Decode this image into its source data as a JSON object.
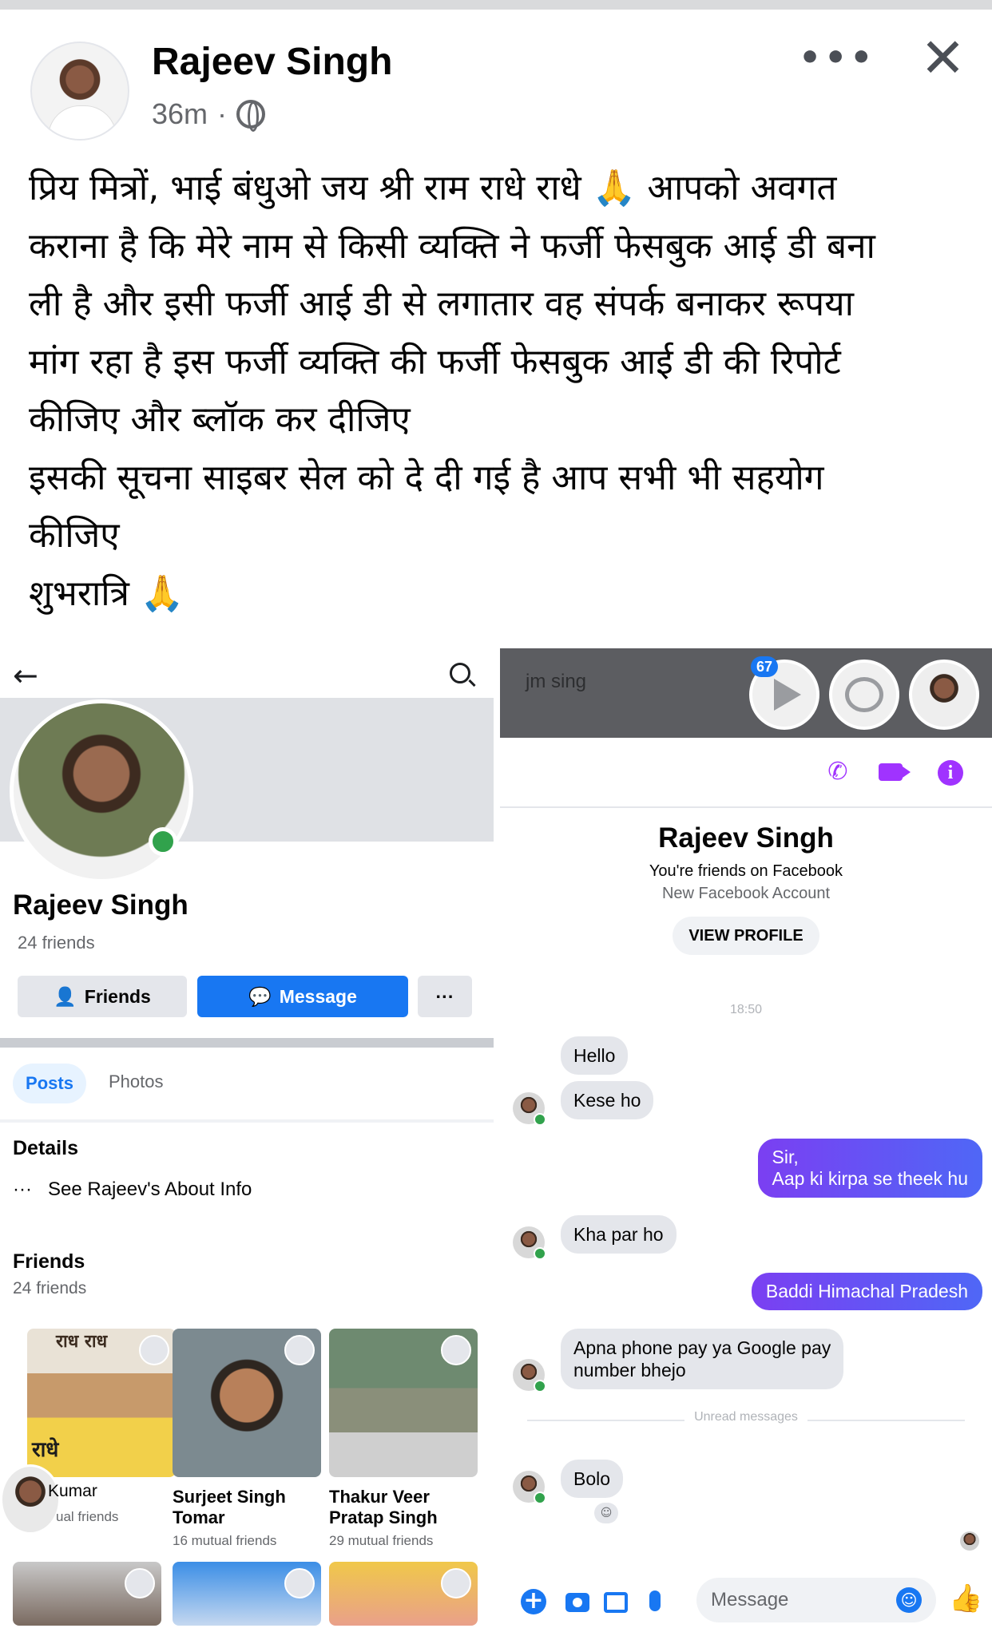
{
  "post": {
    "author": "Rajeev Singh",
    "time": "36m",
    "separator": "·",
    "text_lines": [
      "प्रिय मित्रों, भाई बंधुओ जय श्री राम राधे राधे 🙏 आपको अवगत",
      "कराना है कि मेरे नाम से किसी व्यक्ति ने फर्जी फेसबुक आई डी बना",
      "ली है और इसी फर्जी आई डी से लगातार वह संपर्क बनाकर रूपया",
      "मांग रहा है इस फर्जी व्यक्ति की फर्जी फेसबुक आई डी की रिपोर्ट",
      "कीजिए और ब्लॉक कर दीजिए",
      "इसकी सूचना साइबर सेल को दे दी गई है आप सभी भी सहयोग",
      "कीजिए",
      "शुभरात्रि 🙏"
    ],
    "more_icon": "•••",
    "close_icon": "✕"
  },
  "profile": {
    "back_icon": "←",
    "name": "Rajeev Singh",
    "friends_count": "24 friends",
    "buttons": {
      "friends": "Friends",
      "message": "Message",
      "more": "···"
    },
    "tabs": [
      "Posts",
      "Photos"
    ],
    "details_title": "Details",
    "about_dots": "···",
    "about_text": "See Rajeev's About Info",
    "friends_title": "Friends",
    "friends_sub": "24 friends",
    "friend_cards": [
      {
        "name": "Kumar",
        "mutual": "ual friends",
        "overlay_text_top": "राध राध",
        "overlay_text_bottom": "राधे"
      },
      {
        "name": "Surjeet Singh Tomar",
        "mutual": "16 mutual friends"
      },
      {
        "name": "Thakur Veer Pratap Singh",
        "mutual": "29 mutual friends"
      }
    ]
  },
  "messenger": {
    "chathead_title": "jm sing",
    "badge_count": "67",
    "contact_name": "Rajeev Singh",
    "friends_note": "You're friends on Facebook",
    "account_note": "New Facebook Account",
    "view_profile": "VIEW PROFILE",
    "timestamp": "18:50",
    "unread_label": "Unread messages",
    "messages": [
      {
        "dir": "in",
        "text": "Hello"
      },
      {
        "dir": "in",
        "text": "Kese ho"
      },
      {
        "dir": "out",
        "text": "Sir,\nAap ki kirpa se theek hu"
      },
      {
        "dir": "in",
        "text": "Kha par ho"
      },
      {
        "dir": "out",
        "text": "Baddi Himachal Pradesh"
      },
      {
        "dir": "in",
        "text": "Apna phone pay ya Google pay\nnumber bhejo"
      },
      {
        "dir": "in",
        "text": "Bolo"
      }
    ],
    "input_placeholder": "Message",
    "colors": {
      "accent": "#a033ff",
      "outgoing": "#6e4ef5",
      "facebook_blue": "#1877f2"
    }
  }
}
